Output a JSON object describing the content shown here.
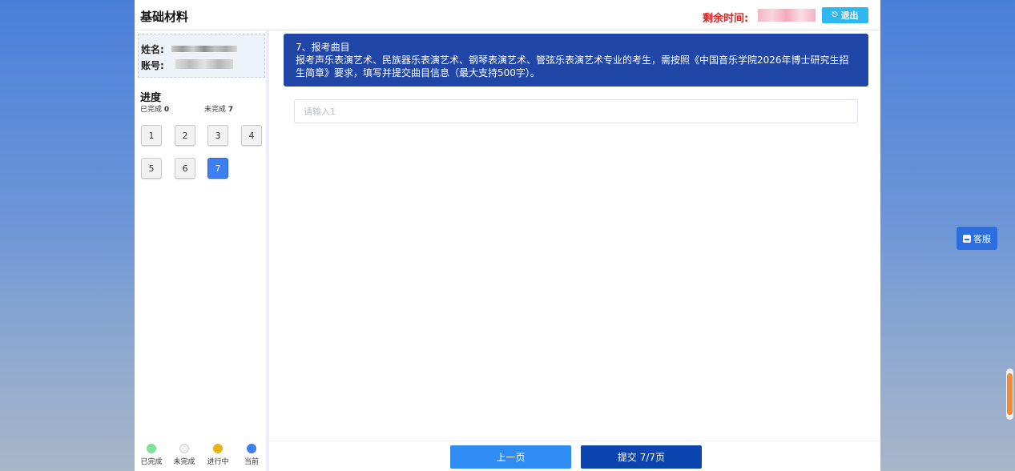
{
  "header": {
    "title": "基础材料",
    "timer_label": "剩余时间:",
    "exit_label": "退出"
  },
  "user": {
    "name_label": "姓名:",
    "account_label": "账号:"
  },
  "progress": {
    "title": "进度",
    "done_label": "已完成",
    "done_count": "0",
    "todo_label": "未完成",
    "todo_count": "7",
    "questions": [
      "1",
      "2",
      "3",
      "4",
      "5",
      "6",
      "7"
    ],
    "current": 7
  },
  "legend": [
    {
      "label": "已完成",
      "color": "#7be39a"
    },
    {
      "label": "未完成",
      "color": "#eeeeee"
    },
    {
      "label": "进行中",
      "color": "#e6b41a"
    },
    {
      "label": "当前",
      "color": "#3d7ef0"
    }
  ],
  "question": {
    "title": "7、报考曲目",
    "description": "报考声乐表演艺术、民族器乐表演艺术、钢琴表演艺术、管弦乐表演艺术专业的考生，需按照《中国音乐学院2026年博士研究生招生简章》要求，填写并提交曲目信息（最大支持500字）。"
  },
  "answer": {
    "value": "",
    "placeholder": "请输入1"
  },
  "footer": {
    "prev_label": "上一页",
    "submit_label": "提交 7/7页"
  },
  "service": {
    "label": "客服"
  },
  "colors": {
    "accent": "#2047a8",
    "timer": "#e01f1f",
    "exit": "#2fb7ef",
    "current_question": "#3d7ef0",
    "scrollbar": "#f08a35"
  }
}
